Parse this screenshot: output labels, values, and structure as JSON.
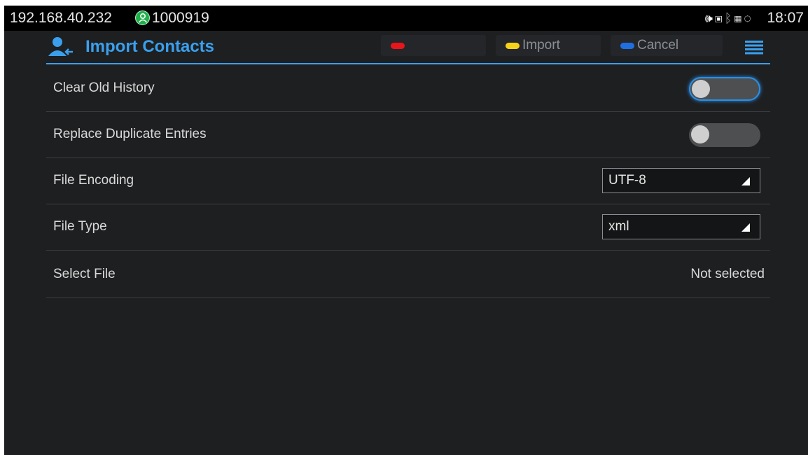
{
  "statusbar": {
    "ip": "192.168.40.232",
    "account": "1000919",
    "time": "18:07",
    "icons": [
      "volume-icon",
      "voicemail-icon",
      "bluetooth-icon",
      "sim-icon",
      "sync-icon"
    ]
  },
  "header": {
    "title": "Import Contacts",
    "softkeys": [
      {
        "color": "#e8151b",
        "label": ""
      },
      {
        "color": "#f5d21a",
        "label": "Import"
      },
      {
        "color": "#1f6fe0",
        "label": "Cancel"
      }
    ]
  },
  "settings": {
    "clear_old_history": {
      "label": "Clear Old History",
      "enabled": false
    },
    "replace_duplicates": {
      "label": "Replace Duplicate Entries",
      "enabled": false
    },
    "file_encoding": {
      "label": "File Encoding",
      "value": "UTF-8"
    },
    "file_type": {
      "label": "File Type",
      "value": "xml"
    },
    "select_file": {
      "label": "Select File",
      "value": "Not selected"
    }
  },
  "colors": {
    "accent": "#3aa0ee",
    "background": "#1e1f21"
  }
}
